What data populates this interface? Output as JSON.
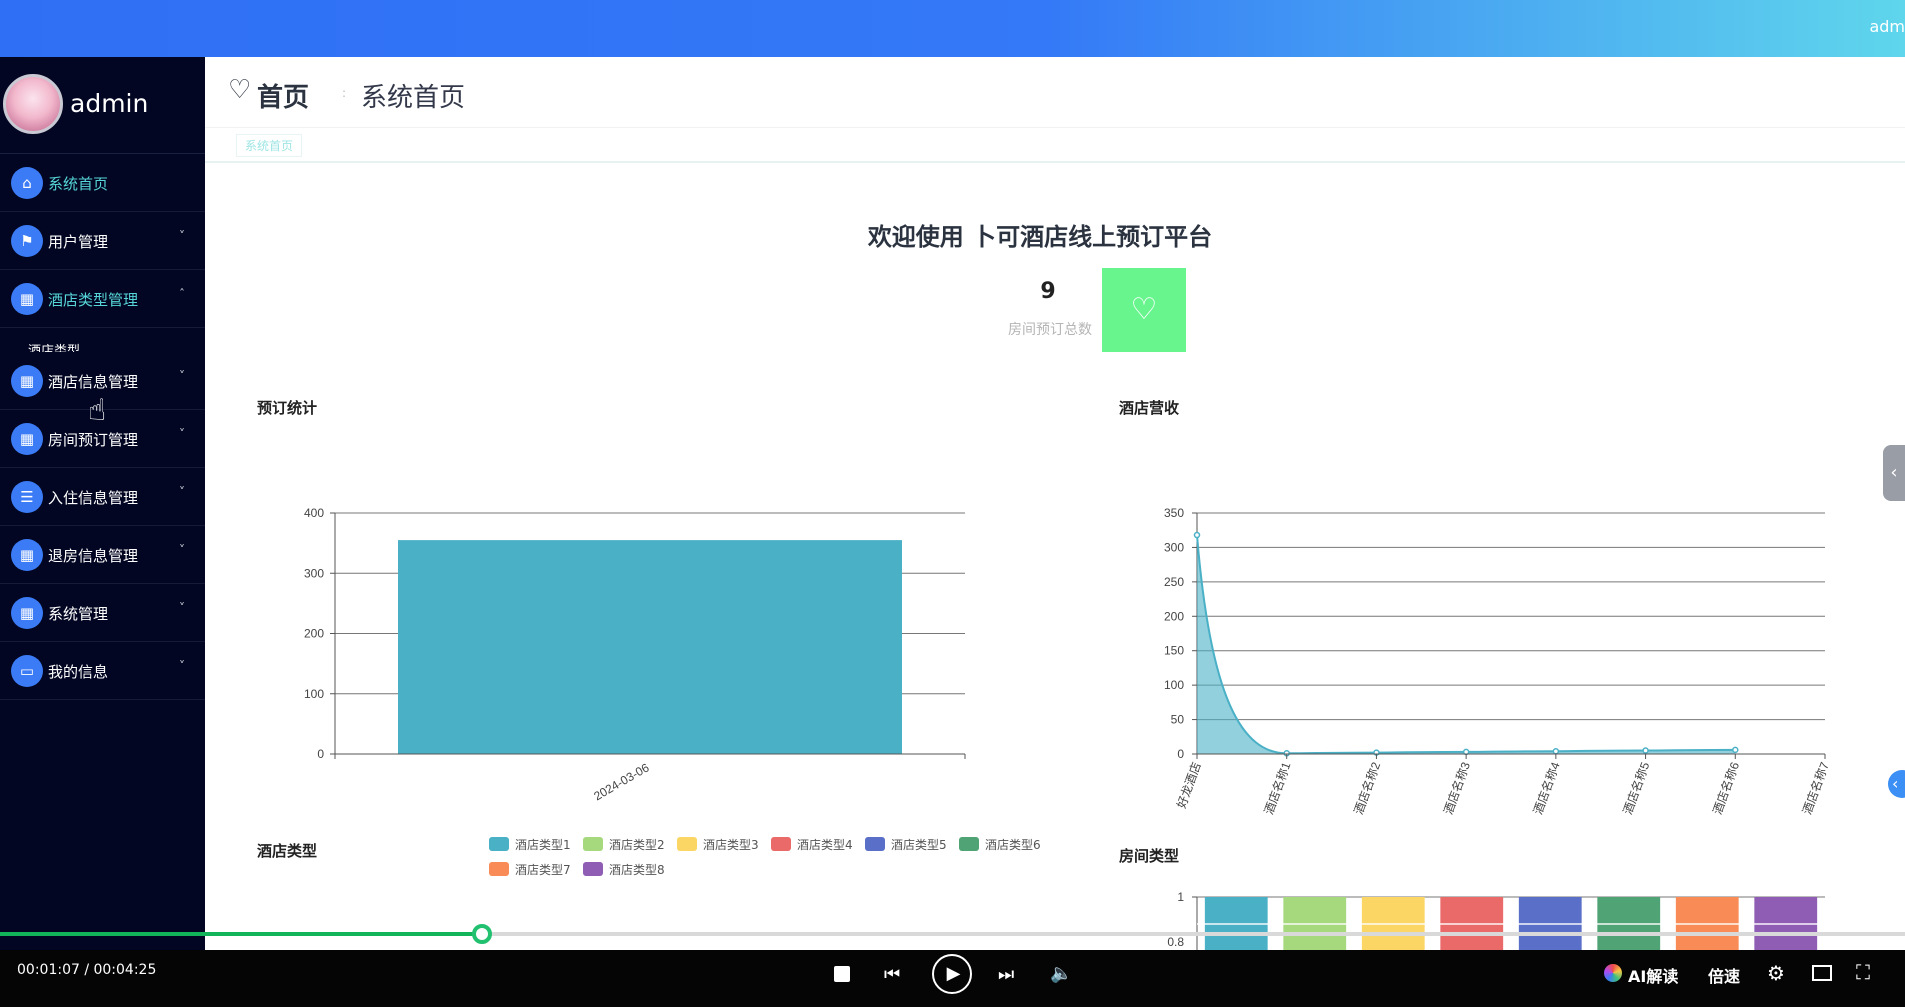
{
  "topbar": {
    "user": "adm"
  },
  "sidebar": {
    "username": "admin",
    "items": [
      {
        "label": "系统首页",
        "icon": "home-icon",
        "glyph": "⌂",
        "active": true,
        "chevron": ""
      },
      {
        "label": "用户管理",
        "icon": "flag-icon",
        "glyph": "⚑",
        "active": false,
        "chevron": "˅"
      },
      {
        "label": "酒店类型管理",
        "icon": "grid-icon",
        "glyph": "▦",
        "active": true,
        "chevron": "ˆ"
      },
      {
        "label": "酒店信息管理",
        "icon": "grid-icon",
        "glyph": "▦",
        "active": false,
        "chevron": "˅"
      },
      {
        "label": "房间预订管理",
        "icon": "grid-icon",
        "glyph": "▦",
        "active": false,
        "chevron": "˅"
      },
      {
        "label": "入住信息管理",
        "icon": "list-icon",
        "glyph": "☰",
        "active": false,
        "chevron": "˅"
      },
      {
        "label": "退房信息管理",
        "icon": "grid-icon",
        "glyph": "▦",
        "active": false,
        "chevron": "˅"
      },
      {
        "label": "系统管理",
        "icon": "grid-icon",
        "glyph": "▦",
        "active": false,
        "chevron": "˅"
      },
      {
        "label": "我的信息",
        "icon": "card-icon",
        "glyph": "▭",
        "active": false,
        "chevron": "˅"
      }
    ],
    "submenu_label": "酒店类型"
  },
  "breadcrumb": {
    "home": "首页",
    "page": "系统首页",
    "separator": ":"
  },
  "tabs": [
    "系统首页"
  ],
  "welcome": "欢迎使用 卜可酒店线上预订平台",
  "stat": {
    "value": "9",
    "label": "房间预订总数"
  },
  "panels": {
    "booking": "预订统计",
    "revenue": "酒店营收",
    "hotel_type": "酒店类型",
    "room_type": "房间类型"
  },
  "legend": [
    {
      "label": "酒店类型1",
      "color": "#4ab0c6"
    },
    {
      "label": "酒店类型2",
      "color": "#a6d87e"
    },
    {
      "label": "酒店类型3",
      "color": "#fcd664"
    },
    {
      "label": "酒店类型4",
      "color": "#ea6a6a"
    },
    {
      "label": "酒店类型5",
      "color": "#5a6fc8"
    },
    {
      "label": "酒店类型6",
      "color": "#4fa374"
    },
    {
      "label": "酒店类型7",
      "color": "#f98c56"
    },
    {
      "label": "酒店类型8",
      "color": "#8f5db4"
    }
  ],
  "chart_data": [
    {
      "type": "bar",
      "title": "预订统计",
      "categories": [
        "2024-03-06"
      ],
      "values": [
        355
      ],
      "ylim": [
        0,
        400
      ],
      "yticks": [
        0,
        100,
        200,
        300,
        400
      ],
      "color": "#4ab0c6",
      "grid": true
    },
    {
      "type": "area",
      "title": "酒店营收",
      "categories": [
        "好龙酒店",
        "酒店名称1",
        "酒店名称2",
        "酒店名称3",
        "酒店名称4",
        "酒店名称5",
        "酒店名称6",
        "酒店名称7"
      ],
      "values": [
        318,
        1,
        2,
        3,
        4,
        5,
        6
      ],
      "ylim": [
        0,
        350
      ],
      "yticks": [
        0,
        50,
        100,
        150,
        200,
        250,
        300,
        350
      ],
      "color": "#4ab0c6",
      "grid": true
    },
    {
      "type": "bar",
      "title": "房间类型",
      "categories": [
        "酒店类型1",
        "酒店类型2",
        "酒店类型3",
        "酒店类型4",
        "酒店类型5",
        "酒店类型6",
        "酒店类型7",
        "酒店类型8"
      ],
      "values": [
        1,
        1,
        1,
        1,
        1,
        1,
        1,
        1
      ],
      "yticks": [
        "1",
        "0.8"
      ],
      "colors": [
        "#4ab0c6",
        "#a6d87e",
        "#fcd664",
        "#ea6a6a",
        "#5a6fc8",
        "#4fa374",
        "#f98c56",
        "#8f5db4"
      ]
    }
  ],
  "player": {
    "time": "00:01:07 / 00:04:25",
    "progress": 0.253,
    "ai_label": "AI解读",
    "speed_label": "倍速"
  }
}
